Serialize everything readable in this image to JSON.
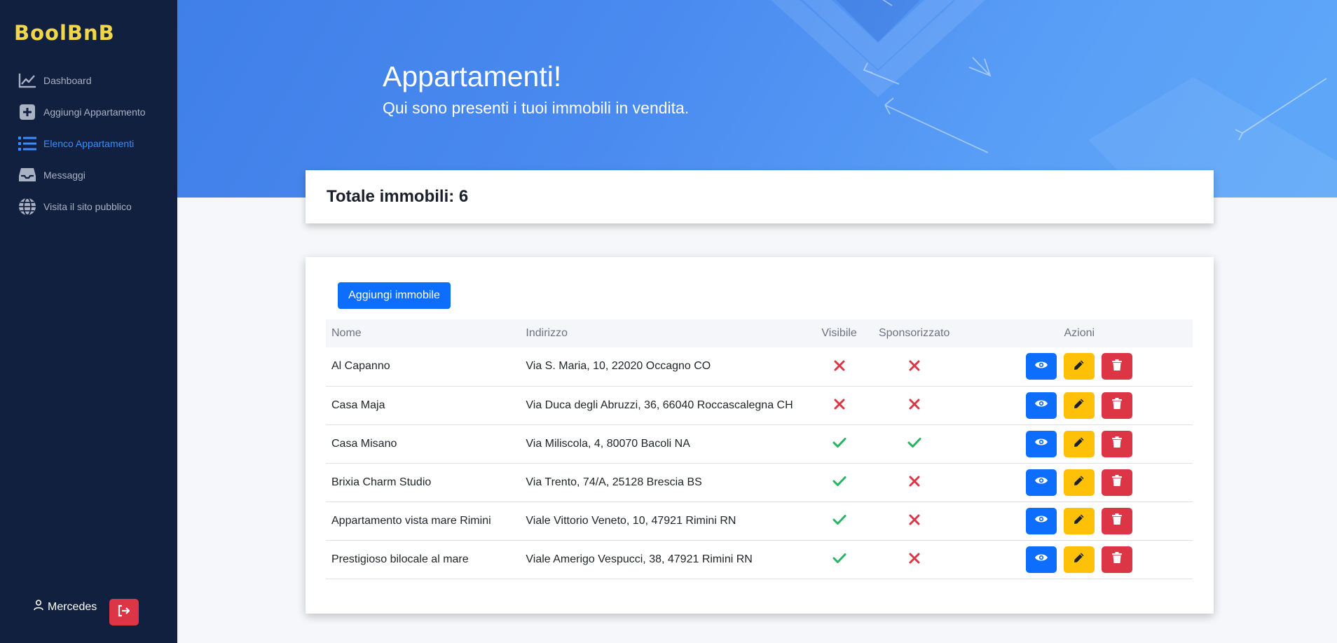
{
  "app": {
    "logo_text": "BoolBnB"
  },
  "sidebar": {
    "items": [
      {
        "label": "Dashboard",
        "icon": "chart-line-icon",
        "active": false
      },
      {
        "label": "Aggiungi Appartamento",
        "icon": "plus-square-icon",
        "active": false
      },
      {
        "label": "Elenco Appartamenti",
        "icon": "list-icon",
        "active": true
      },
      {
        "label": "Messaggi",
        "icon": "inbox-icon",
        "active": false
      },
      {
        "label": "Visita il sito pubblico",
        "icon": "globe-icon",
        "active": false
      }
    ],
    "user": {
      "name": "Mercedes",
      "icon": "user-icon"
    },
    "logout_icon": "logout-icon"
  },
  "header": {
    "title": "Appartamenti!",
    "subtitle": "Qui sono presenti i tuoi immobili in vendita."
  },
  "summary": {
    "total_label": "Totale immobili: 6"
  },
  "table": {
    "add_button_label": "Aggiungi immobile",
    "columns": [
      "Nome",
      "Indirizzo",
      "Visibile",
      "Sponsorizzato",
      "Azioni"
    ],
    "rows": [
      {
        "nome": "Al Capanno",
        "indirizzo": "Via S. Maria, 10, 22020 Occagno CO",
        "visibile": false,
        "sponsorizzato": false
      },
      {
        "nome": "Casa Maja",
        "indirizzo": "Via Duca degli Abruzzi, 36, 66040 Roccascalegna CH",
        "visibile": false,
        "sponsorizzato": false
      },
      {
        "nome": "Casa Misano",
        "indirizzo": "Via Miliscola, 4, 80070 Bacoli NA",
        "visibile": true,
        "sponsorizzato": true
      },
      {
        "nome": "Brixia Charm Studio",
        "indirizzo": "Via Trento, 74/A, 25128 Brescia BS",
        "visibile": true,
        "sponsorizzato": false
      },
      {
        "nome": "Appartamento vista mare Rimini",
        "indirizzo": "Viale Vittorio Veneto, 10, 47921 Rimini RN",
        "visibile": true,
        "sponsorizzato": false
      },
      {
        "nome": "Prestigioso bilocale al mare",
        "indirizzo": "Viale Amerigo Vespucci, 38, 47921 Rimini RN",
        "visibile": true,
        "sponsorizzato": false
      }
    ]
  },
  "colors": {
    "sidebar_bg": "#11203f",
    "logo": "#f2d64a",
    "active_nav": "#3b8cff",
    "primary": "#0d6efd",
    "warning": "#ffc107",
    "danger": "#dc3545",
    "success": "#28b463"
  }
}
